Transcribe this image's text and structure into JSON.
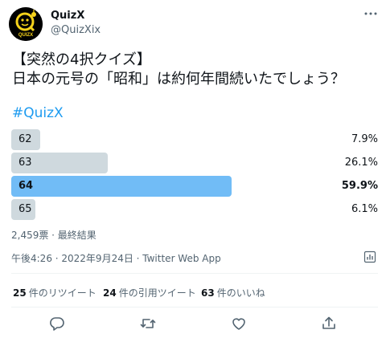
{
  "author": {
    "name": "QuizX",
    "handle": "@QuizXix",
    "avatar_text": "QUIZX"
  },
  "tweet": {
    "text": "【突然の4択クイズ】\n日本の元号の「昭和」は約何年間続いたでしょう？",
    "hashtag": "#QuizX"
  },
  "poll": {
    "options": [
      {
        "label": "62",
        "percent": "7.9%",
        "fraction": 0.079
      },
      {
        "label": "63",
        "percent": "26.1%",
        "fraction": 0.261
      },
      {
        "label": "64",
        "percent": "59.9%",
        "fraction": 0.599,
        "winner": true
      },
      {
        "label": "65",
        "percent": "6.1%",
        "fraction": 0.061
      }
    ],
    "meta": "2,459票 · 最終結果"
  },
  "timestamp": "午後4:26 · 2022年9月24日 · Twitter Web App",
  "stats": {
    "retweets_count": "25",
    "retweets_label": "件のリツイート",
    "quotes_count": "24",
    "quotes_label": "件の引用ツイート",
    "likes_count": "63",
    "likes_label": "件のいいね"
  },
  "colors": {
    "accent": "#1d9bf0",
    "winner_bar": "#71bcf6",
    "bar": "#cfd9de",
    "secondary_text": "#536471"
  },
  "icons": [
    "more-icon",
    "analytics-icon",
    "reply-icon",
    "retweet-icon",
    "like-icon",
    "share-icon"
  ]
}
